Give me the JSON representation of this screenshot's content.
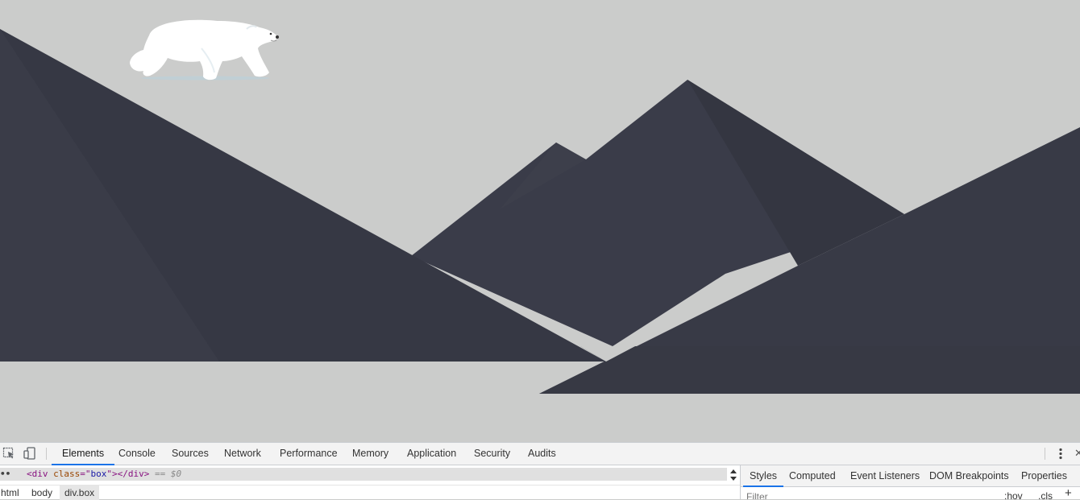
{
  "colors": {
    "sky": "#cbcccb",
    "mountain_dark": "#363844",
    "mountain_mid": "#3a3c48",
    "mountain_light": "#3f414d",
    "bear": "#ffffff",
    "accent": "#1a73e8"
  },
  "scene": {
    "bear_icon": "polar-bear-icon"
  },
  "devtools": {
    "toolbar_icons": [
      "inspect-element-icon",
      "device-toggle-icon"
    ],
    "tabs": [
      {
        "label": "Elements",
        "active": true
      },
      {
        "label": "Console"
      },
      {
        "label": "Sources"
      },
      {
        "label": "Network"
      },
      {
        "label": "Performance"
      },
      {
        "label": "Memory"
      },
      {
        "label": "Application"
      },
      {
        "label": "Security"
      },
      {
        "label": "Audits"
      }
    ],
    "menu_icon": "more-vertical-icon",
    "close_icon": "close-icon",
    "dom": {
      "ellipsis": "••",
      "open_tag": "<div",
      "attr_name": "class",
      "attr_eq": "=\"",
      "attr_value": "box",
      "attr_close": "\">",
      "close_tag": "</div>",
      "selected_marker": "== $0"
    },
    "breadcrumbs": [
      "html",
      "body",
      "div.box"
    ],
    "styles": {
      "tabs": [
        "Styles",
        "Computed",
        "Event Listeners",
        "DOM Breakpoints",
        "Properties"
      ],
      "filter_placeholder": "Filter",
      "hov_label": ":hov",
      "cls_label": ".cls",
      "add_label": "+"
    }
  }
}
